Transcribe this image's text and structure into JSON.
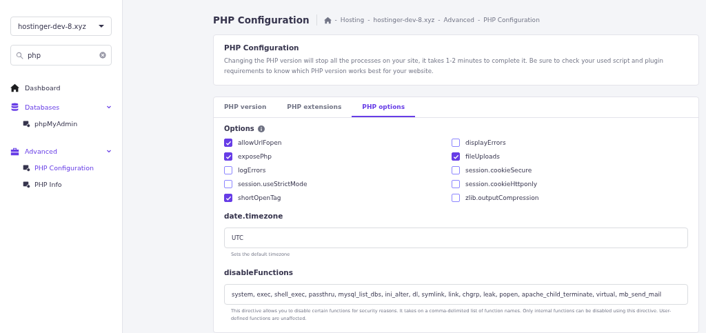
{
  "sidebar": {
    "domain_select": "hostinger-dev-8.xyz",
    "search": {
      "value": "php"
    },
    "items": [
      {
        "label": "Dashboard"
      },
      {
        "label": "Databases",
        "expanded": true,
        "children": [
          {
            "label": "phpMyAdmin",
            "selected": false
          }
        ]
      },
      {
        "label": "Advanced",
        "expanded": true,
        "children": [
          {
            "label": "PHP Configuration",
            "selected": true
          },
          {
            "label": "PHP Info",
            "selected": false
          }
        ]
      }
    ]
  },
  "page_title": "PHP Configuration",
  "breadcrumb": [
    "Hosting",
    "hostinger-dev-8.xyz",
    "Advanced",
    "PHP Configuration"
  ],
  "breadcrumb_separator": "-",
  "info_card": {
    "title": "PHP Configuration",
    "text": "Changing the PHP version will stop all the processes on your site, it takes 1-2 minutes to complete it. Be sure to check your used script and plugin requirements to know which PHP version works best for your website."
  },
  "tabs": [
    {
      "label": "PHP version",
      "selected": false
    },
    {
      "label": "PHP extensions",
      "selected": false
    },
    {
      "label": "PHP options",
      "selected": true
    }
  ],
  "options_title": "Options",
  "options": [
    {
      "label": "allowUrlFopen",
      "checked": true
    },
    {
      "label": "displayErrors",
      "checked": false
    },
    {
      "label": "exposePhp",
      "checked": true
    },
    {
      "label": "fileUploads",
      "checked": true
    },
    {
      "label": "logErrors",
      "checked": false
    },
    {
      "label": "session.cookieSecure",
      "checked": false
    },
    {
      "label": "session.useStrictMode",
      "checked": false
    },
    {
      "label": "session.cookieHttponly",
      "checked": false
    },
    {
      "label": "shortOpenTag",
      "checked": true
    },
    {
      "label": "zlib.outputCompression",
      "checked": false
    }
  ],
  "fields": [
    {
      "label": "date.timezone",
      "value": "UTC",
      "hint": "Sets the default timezone"
    },
    {
      "label": "disableFunctions",
      "value": "system, exec, shell_exec, passthru, mysql_list_dbs, ini_alter, dl, symlink, link, chgrp, leak, popen, apache_child_terminate, virtual, mb_send_mail",
      "hint": "This directive allows you to disable certain functions for security reasons. It takes on a comma-delimited list of function names. Only internal functions can be disabled using this directive. User-defined functions are unaffected."
    }
  ]
}
